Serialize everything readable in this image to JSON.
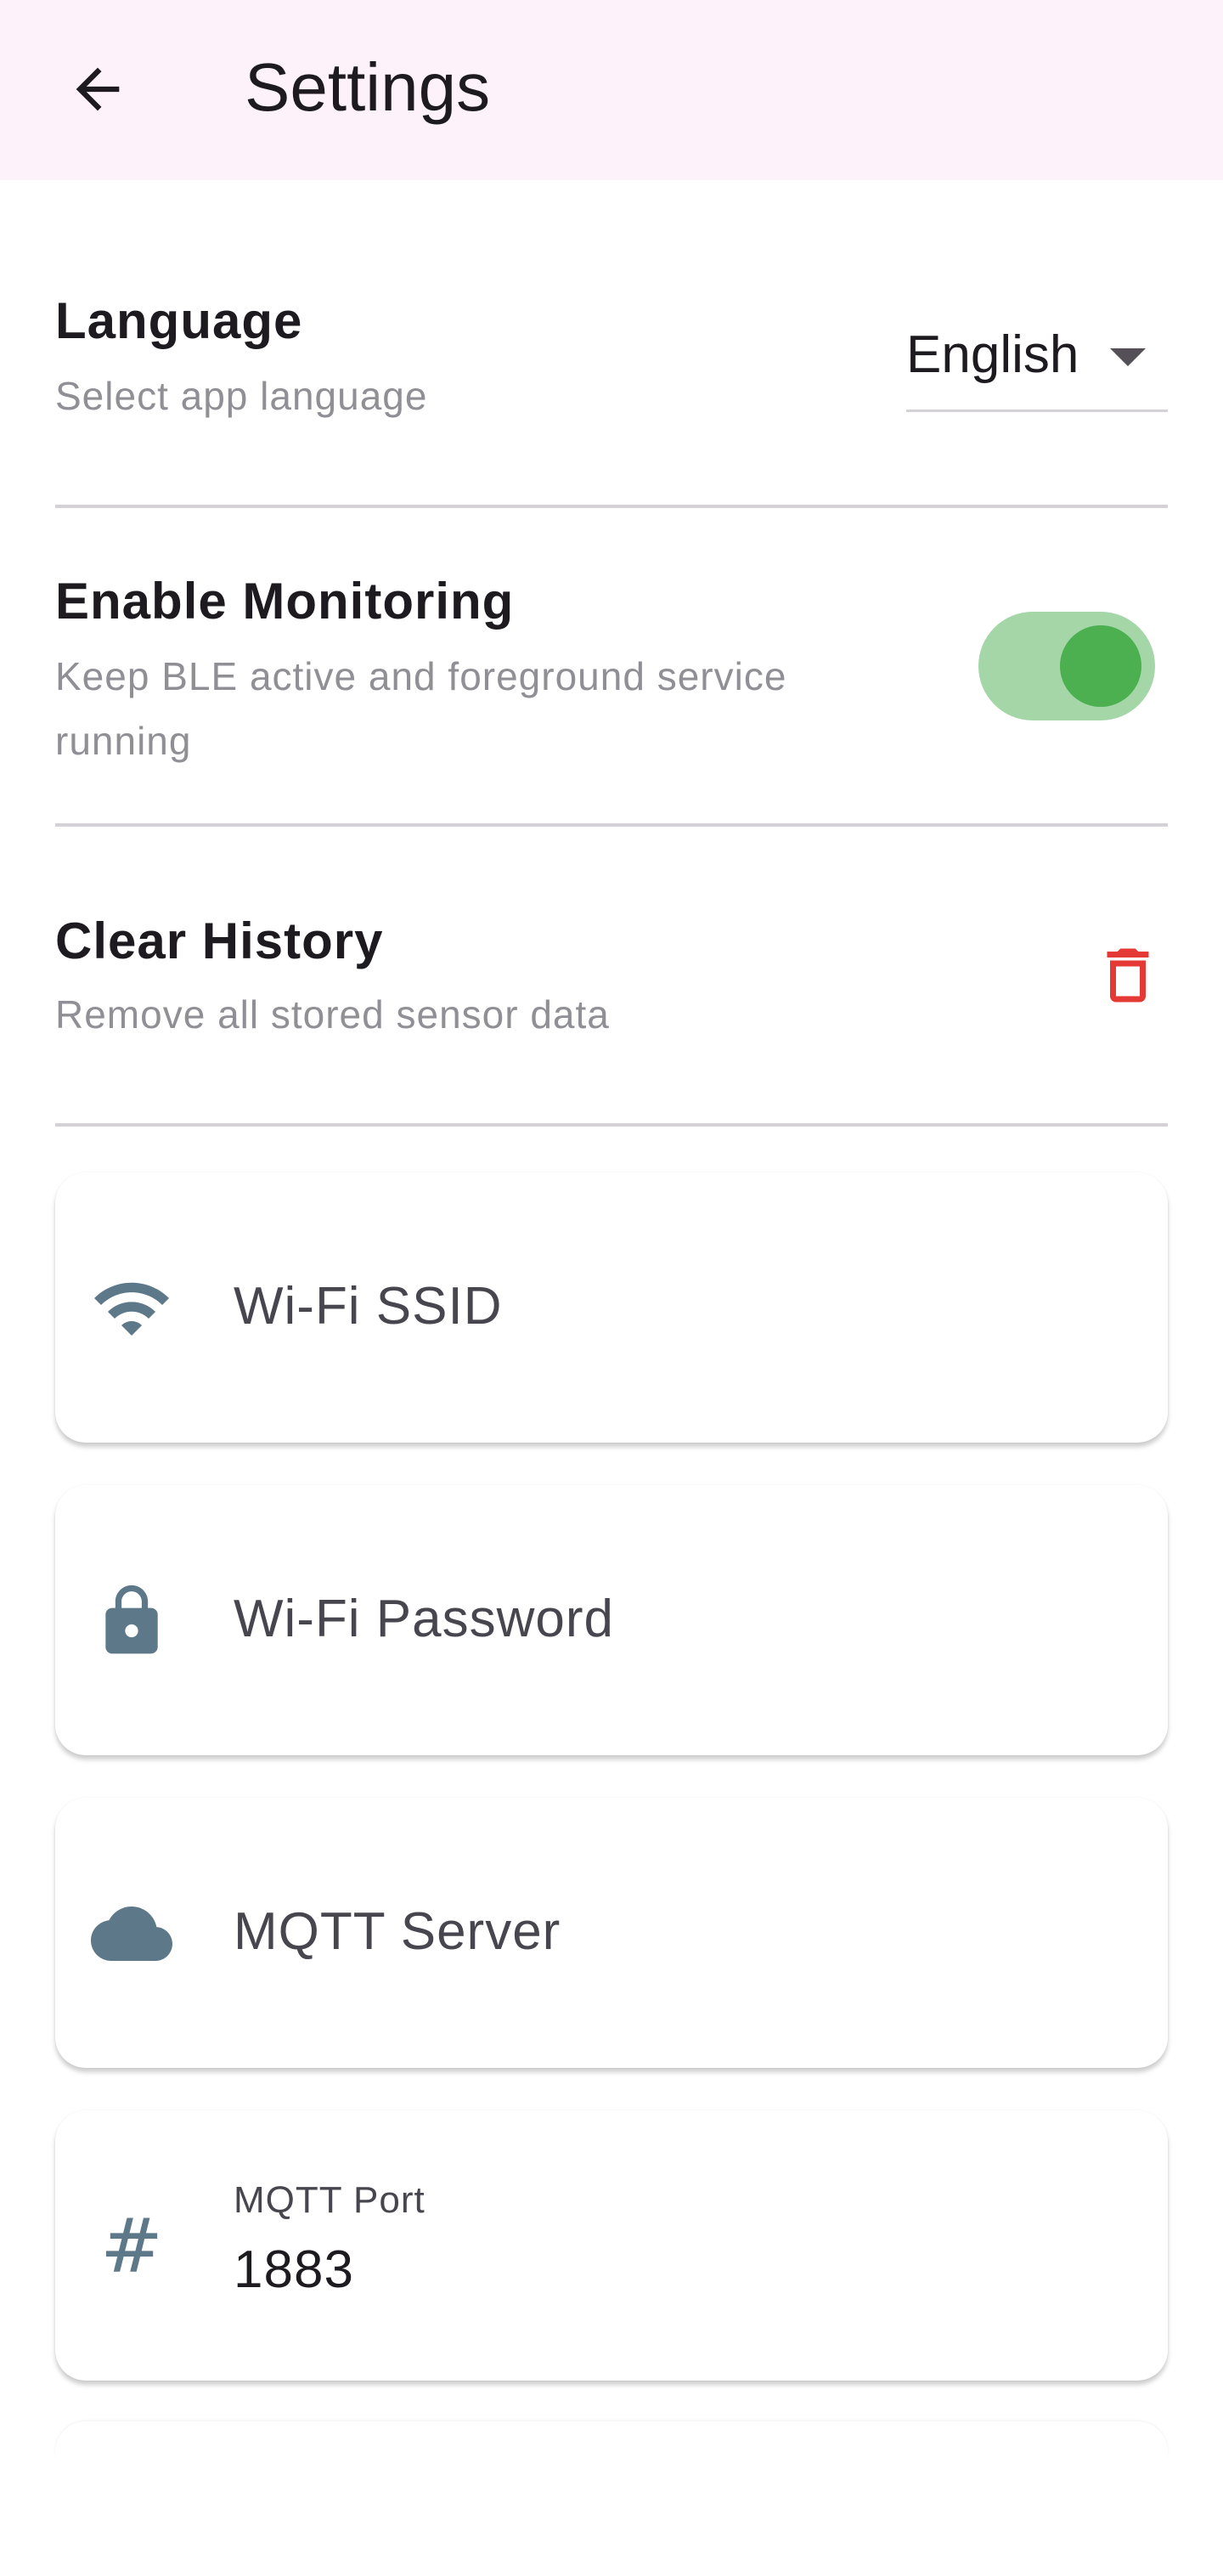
{
  "appbar": {
    "title": "Settings",
    "back_icon": "arrow-back-icon"
  },
  "settings": {
    "language": {
      "title": "Language",
      "subtitle": "Select app language",
      "selected": "English",
      "icon": "dropdown-caret-icon"
    },
    "monitoring": {
      "title": "Enable Monitoring",
      "subtitle": "Keep BLE active and foreground service running",
      "enabled": true
    },
    "clear_history": {
      "title": "Clear History",
      "subtitle": "Remove all stored sensor data",
      "icon": "trash-icon"
    }
  },
  "fields": [
    {
      "label": "Wi-Fi SSID",
      "value": "",
      "icon": "wifi-icon"
    },
    {
      "label": "Wi-Fi Password",
      "value": "",
      "icon": "lock-icon"
    },
    {
      "label": "MQTT Server",
      "value": "",
      "icon": "cloud-icon"
    },
    {
      "label": "MQTT Port",
      "value": "1883",
      "icon": "hash-icon"
    }
  ],
  "colors": {
    "appbar_bg": "#fdf2fa",
    "switch_track": "#a5d6a7",
    "switch_thumb": "#4caf50",
    "danger": "#e53935",
    "field_icon": "#5c7889",
    "subtitle": "#8f8f95"
  }
}
